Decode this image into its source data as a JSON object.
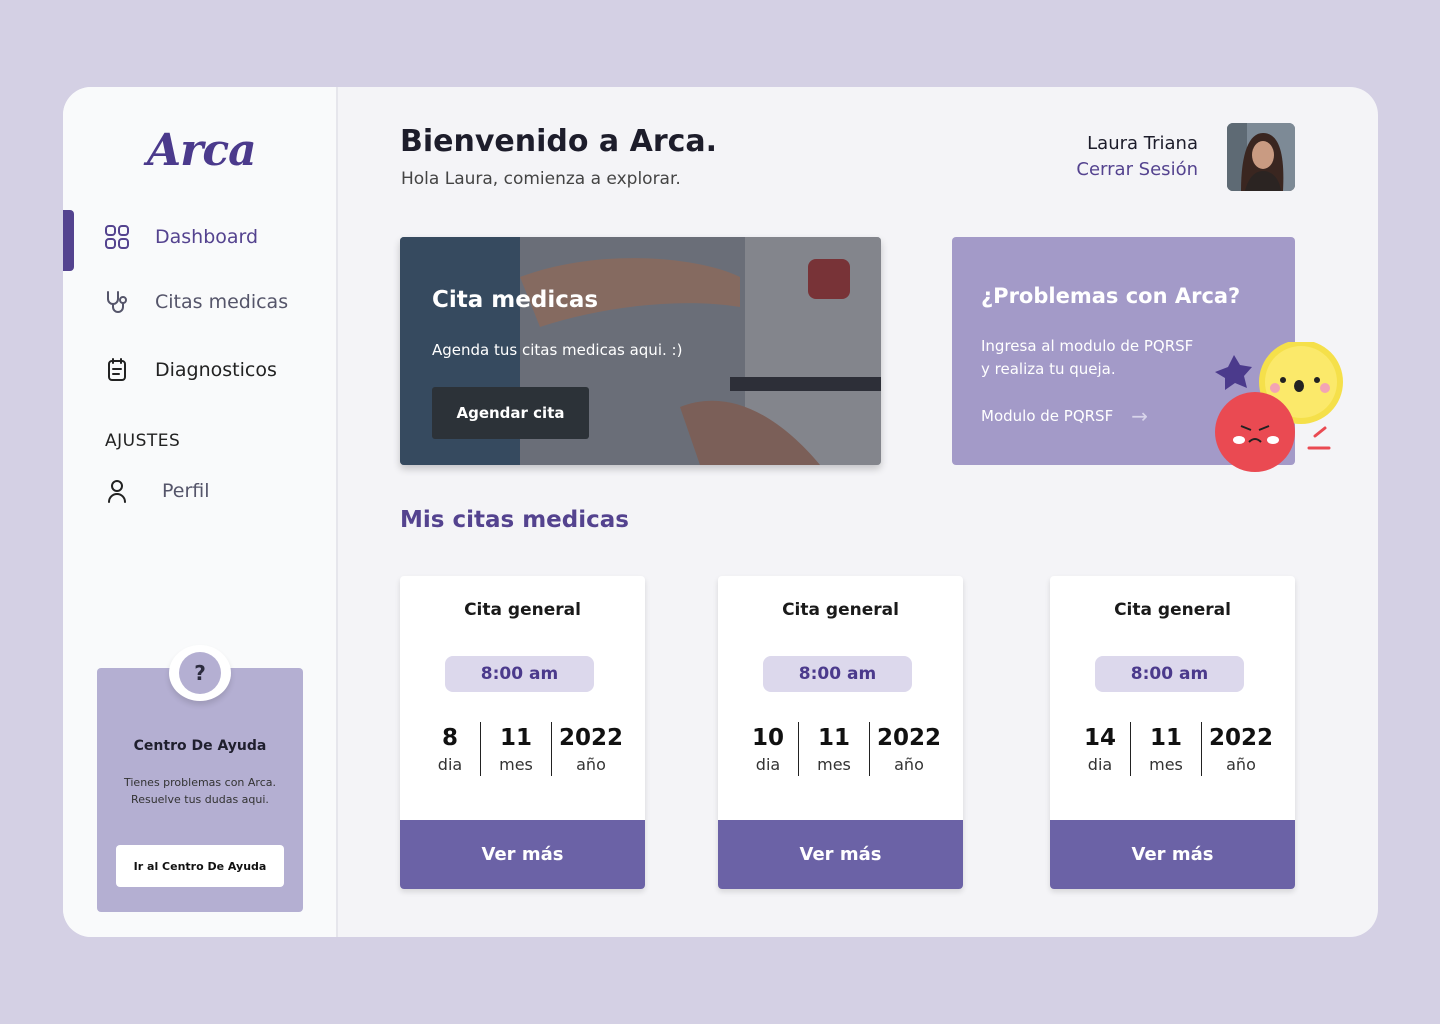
{
  "brand": {
    "logo": "Arca"
  },
  "sidebar": {
    "items": [
      {
        "label": "Dashboard",
        "icon": "grid-icon",
        "active": true
      },
      {
        "label": "Citas medicas",
        "icon": "stethoscope-icon",
        "active": false
      },
      {
        "label": "Diagnosticos",
        "icon": "clipboard-icon",
        "active": false
      }
    ],
    "settings_title": "AJUSTES",
    "settings_items": [
      {
        "label": "Perfil",
        "icon": "user-icon"
      }
    ],
    "help": {
      "badge": "?",
      "title": "Centro De Ayuda",
      "text": "Tienes problemas con Arca. Resuelve tus dudas aqui.",
      "button": "Ir al Centro De Ayuda"
    }
  },
  "header": {
    "title": "Bienvenido a Arca.",
    "subtitle": "Hola Laura, comienza a explorar.",
    "user_name": "Laura Triana",
    "logout": "Cerrar Sesión"
  },
  "hero": {
    "title": "Cita medicas",
    "text": "Agenda tus citas medicas aqui. :)",
    "button": "Agendar cita"
  },
  "pqrsf": {
    "title": "¿Problemas con Arca?",
    "text": "Ingresa al modulo de PQRSF y realiza tu queja.",
    "link": "Modulo de PQRSF"
  },
  "appointments": {
    "title": "Mis citas medicas",
    "day_label": "dia",
    "month_label": "mes",
    "year_label": "año",
    "button": "Ver más",
    "items": [
      {
        "title": "Cita general",
        "time": "8:00 am",
        "day": "8",
        "month": "11",
        "year": "2022"
      },
      {
        "title": "Cita general",
        "time": "8:00 am",
        "day": "10",
        "month": "11",
        "year": "2022"
      },
      {
        "title": "Cita general",
        "time": "8:00 am",
        "day": "14",
        "month": "11",
        "year": "2022"
      }
    ]
  },
  "colors": {
    "accent": "#54438f",
    "card_button": "#6b62a6",
    "panel": "#a39ac8",
    "background": "#d4d0e4"
  }
}
